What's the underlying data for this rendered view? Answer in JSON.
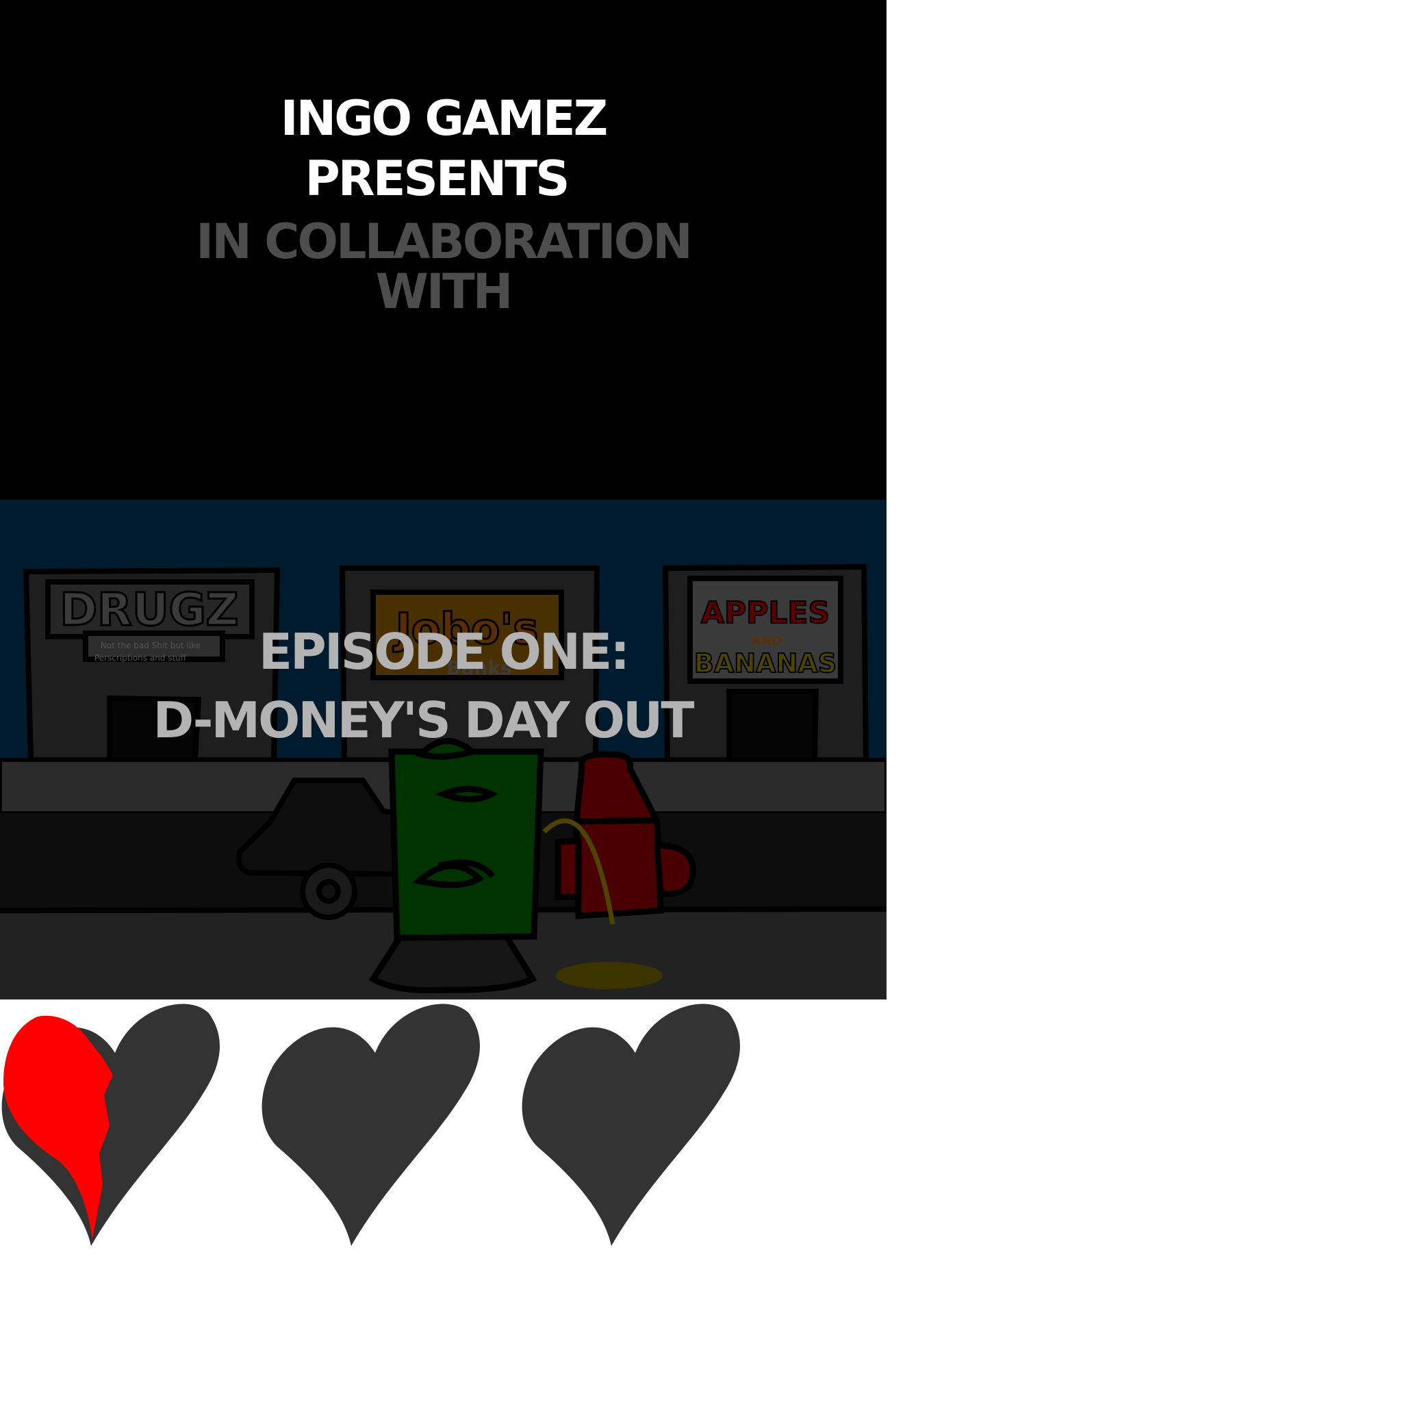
{
  "intro": {
    "line1": "INGO GAMEZ",
    "line2": "PRESENTS",
    "line3": "IN COLLABORATION",
    "line4": "WITH"
  },
  "episode": {
    "line1": "EPISODE ONE:",
    "line2": "D-MONEY'S DAY OUT"
  },
  "scene": {
    "signs": {
      "left": "DRUGZ",
      "left_small_1": "Not the bad Shit but like",
      "left_small_2": "Perscriptions and stuff",
      "middle": "Jobo's",
      "middle_small": "Banks",
      "right_top": "APPLES",
      "right_mid": "AND",
      "right_bottom": "BANANAS"
    }
  },
  "lives": {
    "total": 3,
    "remaining": 0.5,
    "colors": {
      "filled": "#ff0000",
      "empty": "#333333"
    }
  }
}
